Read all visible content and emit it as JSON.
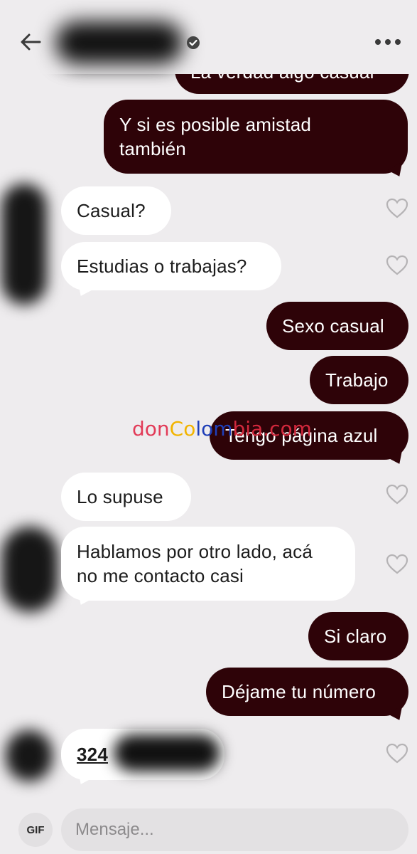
{
  "header": {
    "back_icon": "arrow-left-icon",
    "verified_icon": "verified-badge-icon",
    "more_icon": "more-horizontal-icon"
  },
  "messages": [
    {
      "direction": "out",
      "text": "La verdad algo casual"
    },
    {
      "direction": "out",
      "text_line1": "Y si es posible amistad",
      "text_line2": "también"
    },
    {
      "direction": "in",
      "text": "Casual?"
    },
    {
      "direction": "in",
      "text": "Estudias o trabajas?"
    },
    {
      "direction": "out",
      "text": "Sexo casual"
    },
    {
      "direction": "out",
      "text": "Trabajo"
    },
    {
      "direction": "out",
      "text": "Tengo página azul"
    },
    {
      "direction": "in",
      "text": "Lo supuse"
    },
    {
      "direction": "in",
      "text_line1": "Hablamos por otro lado, acá",
      "text_line2": "no me contacto casi"
    },
    {
      "direction": "out",
      "text": "Si claro"
    },
    {
      "direction": "out",
      "text": "Déjame tu número"
    },
    {
      "direction": "in",
      "text": "324"
    }
  ],
  "watermark": {
    "part1": "don",
    "part2": "Co",
    "part3": "lom",
    "part4": "bia.com"
  },
  "composer": {
    "gif_label": "GIF",
    "placeholder": "Mensaje..."
  },
  "colors": {
    "outgoing_bubble": "#2e0308",
    "incoming_bubble": "#ffffff",
    "background": "#eeecee"
  }
}
